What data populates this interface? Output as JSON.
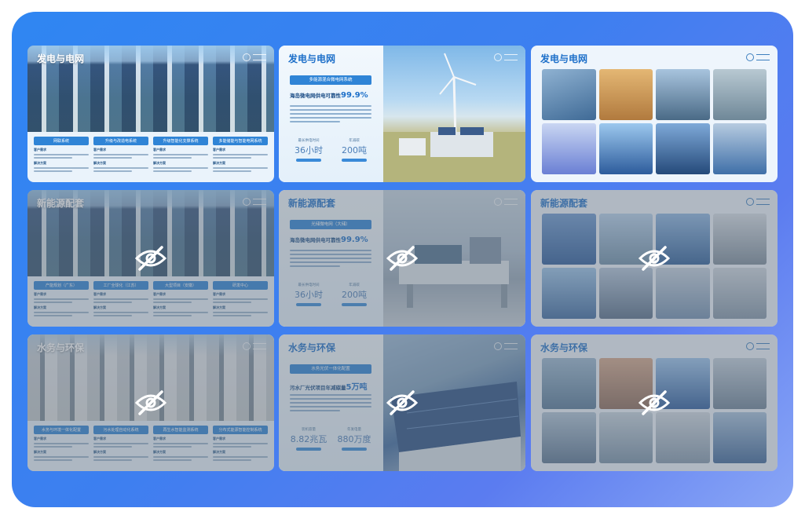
{
  "slides": {
    "s1": {
      "title": "发电与电网",
      "boxes": [
        {
          "header": "网联系统",
          "label1": "客户需求",
          "label2": "解决方案"
        },
        {
          "header": "升级与改造电系统",
          "label1": "客户需求",
          "label2": "解决方案"
        },
        {
          "header": "升级智能化支撑系统",
          "label1": "客户需求",
          "label2": "解决方案"
        },
        {
          "header": "多能储能与智能电网系统",
          "label1": "客户需求",
          "label2": "解决方案"
        }
      ]
    },
    "s2": {
      "title": "发电与电网",
      "tagline": "多能源混合微电网系统",
      "headline_prefix": "海岛微电网供电可靠性",
      "headline_value": "99.9%",
      "stat1": {
        "caption": "最长供电时间",
        "value": "36小时"
      },
      "stat2": {
        "caption": "年减碳",
        "value": "200吨"
      }
    },
    "s3": {
      "title": "发电与电网"
    },
    "s4": {
      "title": "新能源配套",
      "boxes": [
        {
          "header": "产能规划（广东）",
          "label1": "客户需求",
          "label2": "解决方案"
        },
        {
          "header": "工厂全球化（江苏）",
          "label1": "客户需求",
          "label2": "解决方案"
        },
        {
          "header": "大型项目（安徽）",
          "label1": "客户需求",
          "label2": "解决方案"
        },
        {
          "header": "研发中心",
          "label1": "客户需求",
          "label2": "解决方案"
        }
      ]
    },
    "s5": {
      "title": "新能源配套",
      "tagline": "光储微电网（大储）",
      "headline_prefix": "海岛微电网供电可靠性",
      "headline_value": "99.9%",
      "stat1": {
        "caption": "最长供电时间",
        "value": "36小时"
      },
      "stat2": {
        "caption": "年减碳",
        "value": "200吨"
      }
    },
    "s6": {
      "title": "新能源配套"
    },
    "s7": {
      "title": "水务与环保",
      "boxes": [
        {
          "header": "水务与环境一体化配置",
          "label1": "客户需求",
          "label2": "解决方案"
        },
        {
          "header": "污水处理自动化系统",
          "label1": "客户需求",
          "label2": "解决方案"
        },
        {
          "header": "再生水智能监测系统",
          "label1": "客户需求",
          "label2": "解决方案"
        },
        {
          "header": "分布式能源智能控制系统",
          "label1": "客户需求",
          "label2": "解决方案"
        }
      ]
    },
    "s8": {
      "title": "水务与环保",
      "tagline": "水务光伏一体化配置",
      "headline_prefix": "污水厂光伏项目年减碳量",
      "headline_value": "5万吨",
      "stat1": {
        "caption": "装机容量",
        "value": "8.82兆瓦"
      },
      "stat2": {
        "caption": "年发电量",
        "value": "880万度"
      }
    },
    "s9": {
      "title": "水务与环保"
    }
  },
  "colors": {
    "frame_gradient": [
      "#2f86f2",
      "#8aa6f6"
    ],
    "accent": "#2f84d6",
    "headline": "#1e70c9"
  },
  "icons": {
    "hidden": "eye-slash-icon",
    "brand": "brand-logo"
  }
}
